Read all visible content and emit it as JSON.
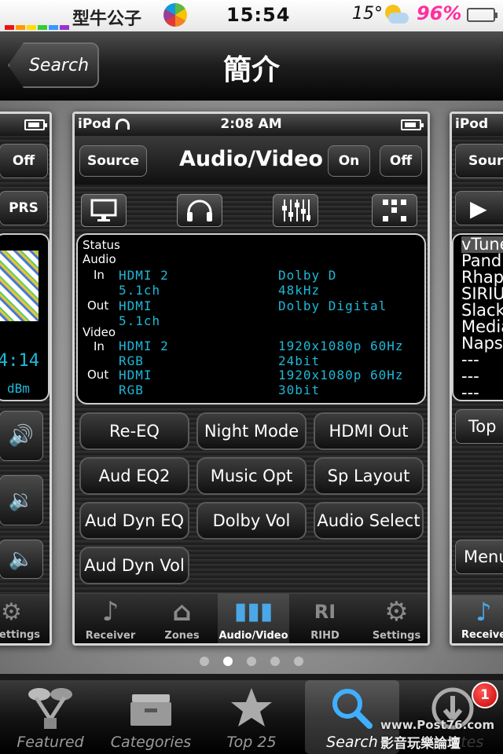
{
  "status_bar": {
    "carrier": "型牛公子",
    "time": "15:54",
    "temperature": "15°",
    "battery_percent": "96%"
  },
  "nav": {
    "back_label": "Search",
    "title": "簡介"
  },
  "screenshot": {
    "device": "iPod",
    "time": "2:08 AM",
    "header": {
      "source": "Source",
      "title": "Audio/Video",
      "on": "On",
      "off": "Off"
    },
    "status": {
      "status_label": "Status",
      "audio_label": "Audio",
      "audio_in_label": "In",
      "audio_in": [
        "HDMI 2",
        "5.1ch"
      ],
      "audio_in_detail": [
        "Dolby D",
        "48kHz"
      ],
      "audio_out_label": "Out",
      "audio_out": [
        "HDMI",
        "5.1ch"
      ],
      "audio_out_detail": "Dolby Digital",
      "video_label": "Video",
      "video_in_label": "In",
      "video_in": [
        "HDMI 2",
        "RGB"
      ],
      "video_in_detail": [
        "1920x1080p 60Hz",
        "24bit"
      ],
      "video_out_label": "Out",
      "video_out": [
        "HDMI",
        "RGB"
      ],
      "video_out_detail": [
        "1920x1080p 60Hz",
        "30bit"
      ]
    },
    "buttons": [
      "Re-EQ",
      "Night Mode",
      "HDMI Out",
      "Aud EQ2",
      "Music Opt",
      "Sp Layout",
      "Aud Dyn EQ",
      "Dolby Vol",
      "Audio Select",
      "Aud Dyn Vol"
    ],
    "tabs": [
      "Receiver",
      "Zones",
      "Audio/Video",
      "RIHD",
      "Settings"
    ],
    "left_partial": {
      "off": "Off",
      "prs": "PRS",
      "time": "4:14",
      "dbm": "dBm",
      "settings": "ettings"
    },
    "right_partial": {
      "device": "iPod",
      "source": "Sourc",
      "list": [
        "vTune",
        "Pand",
        "Rhap",
        "SIRIU",
        "Slack",
        "Media",
        "Naps",
        "---",
        "---",
        "---"
      ],
      "top": "Top",
      "menu": "Menu",
      "receiver": "Receive"
    }
  },
  "tabbar": {
    "items": [
      "Featured",
      "Categories",
      "Top 25",
      "Search",
      "Updates"
    ],
    "badge": "1"
  },
  "watermark": {
    "line1": "www.Post76.com",
    "line2": "影音玩樂論壇"
  },
  "colors": {
    "accent": "#1fb8d8",
    "badge": "#d40000",
    "battery_pct": "#ff2fa0"
  }
}
